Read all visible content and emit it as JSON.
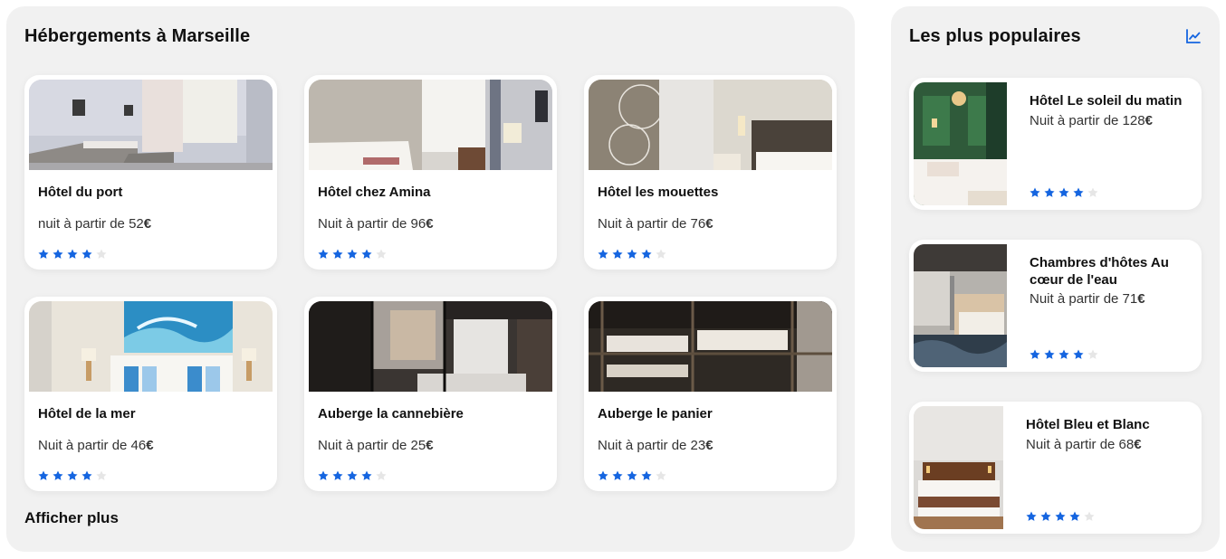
{
  "main": {
    "title": "Hébergements à Marseille",
    "more_label": "Afficher plus",
    "hotels": [
      {
        "name": "Hôtel du port",
        "price_prefix": "nuit à partir de ",
        "price_value": "52",
        "currency": "€",
        "rating": 4,
        "max_rating": 5
      },
      {
        "name": "Hôtel chez Amina",
        "price_prefix": "Nuit à partir de ",
        "price_value": "96",
        "currency": "€",
        "rating": 4,
        "max_rating": 5
      },
      {
        "name": "Hôtel les mouettes",
        "price_prefix": "Nuit à partir de ",
        "price_value": "76",
        "currency": "€",
        "rating": 4,
        "max_rating": 5
      },
      {
        "name": "Hôtel de la mer",
        "price_prefix": "Nuit à partir de ",
        "price_value": "46",
        "currency": "€",
        "rating": 4,
        "max_rating": 5
      },
      {
        "name": "Auberge la cannebière",
        "price_prefix": "Nuit à partir de ",
        "price_value": "25",
        "currency": "€",
        "rating": 4,
        "max_rating": 5
      },
      {
        "name": "Auberge le panier",
        "price_prefix": "Nuit à partir de ",
        "price_value": "23",
        "currency": "€",
        "rating": 4,
        "max_rating": 5
      }
    ]
  },
  "popular": {
    "title": "Les plus populaires",
    "icon": "chart-line-icon",
    "hotels": [
      {
        "name": "Hôtel Le soleil du matin",
        "price_prefix": "Nuit à partir de ",
        "price_value": "128",
        "currency": "€",
        "rating": 4,
        "max_rating": 5
      },
      {
        "name": "Chambres d'hôtes Au cœur de l'eau",
        "price_prefix": "Nuit à partir de ",
        "price_value": "71",
        "currency": "€",
        "rating": 4,
        "max_rating": 5
      },
      {
        "name": "Hôtel Bleu et Blanc",
        "price_prefix": "Nuit à partir de ",
        "price_value": "68",
        "currency": "€",
        "rating": 4,
        "max_rating": 5
      }
    ]
  },
  "colors": {
    "accent": "#1565e0",
    "star_filled": "#1565e0",
    "star_empty": "#e6e6e6",
    "panel_bg": "#f1f1f1",
    "card_bg": "#ffffff"
  }
}
